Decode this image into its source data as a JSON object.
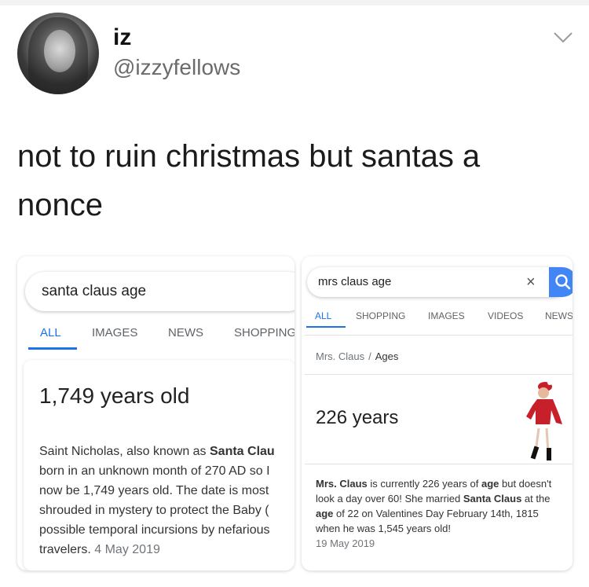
{
  "tweet": {
    "name": "iz",
    "handle": "@izzyfellows",
    "text": "not to ruin christmas but santas a\nnonce"
  },
  "left_card": {
    "query": "santa claus age",
    "tabs": [
      "ALL",
      "IMAGES",
      "NEWS",
      "SHOPPING"
    ],
    "active_tab": "ALL",
    "answer": "1,749 years old",
    "description": "Saint Nicholas, also known as Santa Clau\nborn in an unknown month of 270 AD so I\nnow be 1,749 years old. The date is most\nshrouded in mystery to protect the Baby (\npossible temporal incursions by nefarious\ntravelers. ",
    "desc_bold": [
      "Santa Clau"
    ],
    "date": "4 May 2019"
  },
  "right_card": {
    "query": "mrs claus age",
    "clear_symbol": "×",
    "tabs": [
      "ALL",
      "SHOPPING",
      "IMAGES",
      "VIDEOS",
      "NEWS"
    ],
    "active_tab": "ALL",
    "breadcrumb": [
      "Mrs. Claus",
      "Ages"
    ],
    "answer": "226 years",
    "description_parts": [
      {
        "t": "Mrs. Claus",
        "b": true
      },
      {
        "t": " is currently 226 years of ",
        "b": false
      },
      {
        "t": "age",
        "b": true
      },
      {
        "t": " but doesn't look a day over 60! She married ",
        "b": false
      },
      {
        "t": "Santa Claus",
        "b": true
      },
      {
        "t": " at the ",
        "b": false
      },
      {
        "t": "age",
        "b": true
      },
      {
        "t": " of 22 on Valentines Day February 14th, 1815 when he was 1,545 years old!",
        "b": false
      }
    ],
    "date": "19 May 2019"
  },
  "icons": {
    "chevron": "chevron-down-icon",
    "search": "search-icon",
    "clear": "close-icon"
  },
  "colors": {
    "accent_blue": "#1a73e8",
    "search_button": "#4285f4",
    "handle_gray": "#6b6b6b"
  }
}
